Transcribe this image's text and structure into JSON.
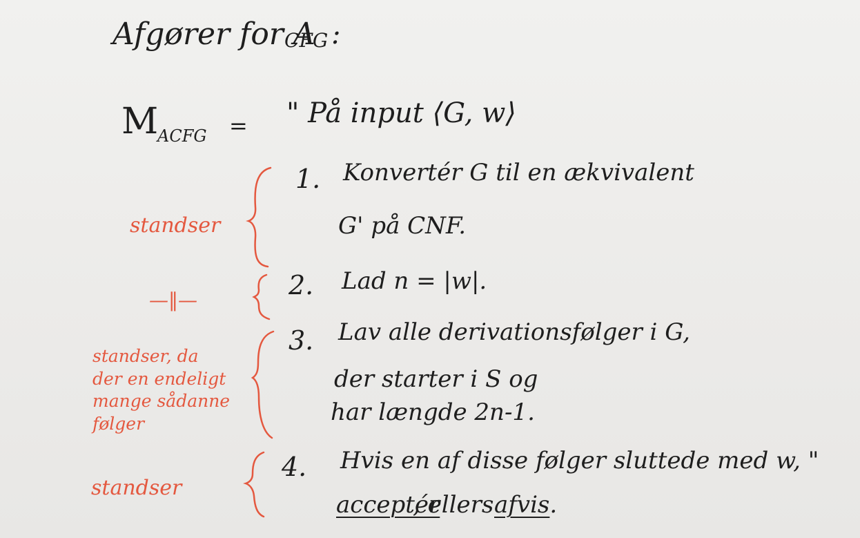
{
  "title": {
    "main": "Afgører for A",
    "sub": "C",
    "subsub": "FG",
    "colon": ":"
  },
  "machine": {
    "symbol": "M",
    "subscript": "ACFG",
    "equals": "=",
    "input": "\" På input ⟨G, w⟩"
  },
  "steps": [
    {
      "number": "1.",
      "lines": [
        "Konvertér G til en ækvivalent",
        "G' på CNF."
      ]
    },
    {
      "number": "2.",
      "lines": [
        "Lad n = |w|."
      ]
    },
    {
      "number": "3.",
      "lines": [
        "Lav alle derivationsfølger i G,",
        "der starter i S og",
        "har længde 2n-1."
      ]
    },
    {
      "number": "4.",
      "lines": [
        "Hvis en af disse følger sluttede med w, \""
      ],
      "accept": "acceptér",
      "else": ", ellers",
      "reject": "afvis",
      "end": "."
    }
  ],
  "notes": {
    "n1": "standser",
    "n2": "—‖—",
    "n3": [
      "standser, da",
      "der en endeligt",
      "mange sådanne",
      "følger"
    ],
    "n4": "standser"
  },
  "colors": {
    "ink": "#1e1e1e",
    "annotation": "#e4583f",
    "board": "#ededeb"
  }
}
